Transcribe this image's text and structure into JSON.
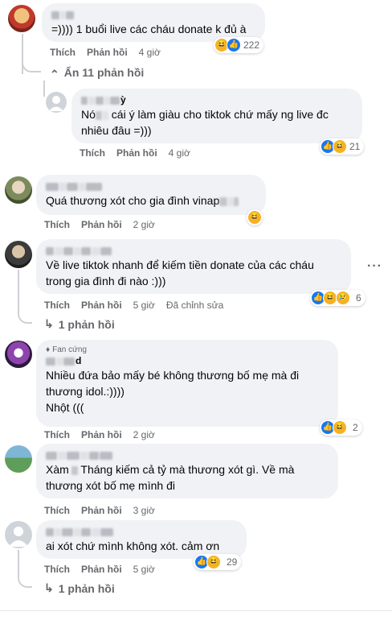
{
  "comments": [
    {
      "text": "=)))) 1 buổi live các cháu donate k đủ à",
      "like": "Thích",
      "reply": "Phản hồi",
      "time": "4 giờ",
      "reaction_count": "222"
    },
    {
      "hide_replies": "Ẩn 11 phản hồi"
    },
    {
      "author_suffix": "ỳ",
      "text_prefix": "Nó",
      "text_rest": " cái ý làm giàu cho tiktok chứ mấy ng live đc nhiêu đâu =)))",
      "like": "Thích",
      "reply": "Phản hồi",
      "time": "4 giờ",
      "reaction_count": "21"
    },
    {
      "text": "Quá thương xót cho gia đình vinap",
      "like": "Thích",
      "reply": "Phản hồi",
      "time": "2 giờ"
    },
    {
      "text": "Về live tiktok nhanh để kiếm tiền donate của các cháu trong gia đình đi nào :)))",
      "like": "Thích",
      "reply": "Phản hồi",
      "time": "5 giờ",
      "edited": "Đã chỉnh sửa",
      "reaction_count": "6",
      "replies": "1 phản hồi"
    },
    {
      "badge": "Fan cứng",
      "author_suffix": "d",
      "line1": "Nhiều đứa bảo mấy bé không thương bố mẹ mà đi thương idol.:))))",
      "line2": "Nhột (((",
      "like": "Thích",
      "reply": "Phản hồi",
      "time": "2 giờ",
      "reaction_count": "2"
    },
    {
      "text_prefix": "Xàm",
      "text_rest": " Tháng kiếm cả tỷ mà thương xót gì. Về mà thương xót bố mẹ mình đi",
      "like": "Thích",
      "reply": "Phản hồi",
      "time": "3 giờ"
    },
    {
      "text": "ai xót chứ mình không xót. cảm ơn",
      "like": "Thích",
      "reply": "Phản hồi",
      "time": "5 giờ",
      "reaction_count": "29",
      "replies": "1 phản hồi"
    }
  ],
  "icons": {
    "haha": "😆",
    "like": "👍",
    "sad": "😢",
    "chevron": "⌃",
    "reply_arrow": "↳",
    "more": "···"
  },
  "colors": {
    "bubble": "#f0f2f5",
    "meta": "#65676b",
    "like_blue": "#1877f2"
  }
}
